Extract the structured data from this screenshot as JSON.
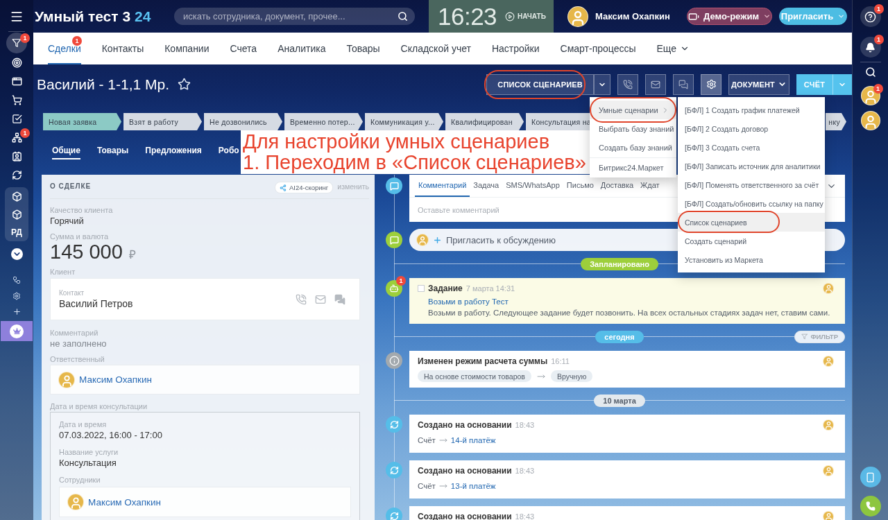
{
  "header": {
    "portal_name": "Умный тест 3",
    "portal_number": "24",
    "search": {
      "placeholder": "искать сотрудника, документ, прочее..."
    },
    "clock": {
      "time": "16:23",
      "start_button": "НАЧАТЬ"
    },
    "user": {
      "name": "Максим Охапкин"
    },
    "demo_button": "Демо-режим",
    "invite_button": "Пригласить"
  },
  "left_sidebar": {
    "filter_badge": "1",
    "people_badge": "1",
    "group_label": "РД"
  },
  "right_sidebar": {
    "help_badge": "1",
    "bell_badge": "1",
    "avatar_badge": "1"
  },
  "nav": {
    "tabs": [
      {
        "label": "Сделки",
        "selected": true,
        "badge": "1"
      },
      {
        "label": "Контакты",
        "selected": false
      },
      {
        "label": "Компании",
        "selected": false
      },
      {
        "label": "Счета",
        "selected": false
      },
      {
        "label": "Аналитика",
        "selected": false
      },
      {
        "label": "Товары",
        "selected": false
      },
      {
        "label": "Складской учет",
        "selected": false
      },
      {
        "label": "Настройки",
        "selected": false
      },
      {
        "label": "Смарт-процессы",
        "selected": false
      }
    ],
    "more": "Еще"
  },
  "deal": {
    "title": "Василий - 1-1,1 Мр.",
    "starred": false
  },
  "toolbar": {
    "scenarios_button": {
      "label": "СПИСОК СЦЕНАРИЕВ",
      "circled": true
    },
    "document_button": "ДОКУМЕНТ",
    "invoice_button": "СЧЁТ"
  },
  "stages": [
    {
      "label": "Новая заявка",
      "selected": true
    },
    {
      "label": "Взят в работу",
      "selected": false
    },
    {
      "label": "Не дозвонились",
      "selected": false
    },
    {
      "label": "Временно потер...",
      "selected": false
    },
    {
      "label": "Коммуникация у...",
      "selected": false
    },
    {
      "label": "Квалифицирован",
      "selected": false
    },
    {
      "label": "Консультация на",
      "selected": false
    },
    {
      "label": "нку",
      "selected": false
    }
  ],
  "detail_tabs": [
    {
      "label": "Общие",
      "selected": true
    },
    {
      "label": "Товары",
      "selected": false
    },
    {
      "label": "Предложения",
      "selected": false
    },
    {
      "label": "Робо",
      "selected": false
    }
  ],
  "about": {
    "title": "О СДЕЛКЕ",
    "scoring_badge": "AI24-скоринг",
    "edit_link": "изменить",
    "fields": [
      {
        "kind": "text",
        "label": "Качество клиента",
        "value": "Горячий",
        "muted": false
      },
      {
        "kind": "amount",
        "label": "Сумма и валюта",
        "value": "145 000",
        "currency": "₽"
      },
      {
        "kind": "contact",
        "label": "Клиент",
        "contact_label": "Контакт",
        "value": "Василий Петров"
      },
      {
        "kind": "text",
        "label": "Комментарий",
        "value": "не заполнено",
        "muted": true
      },
      {
        "kind": "person",
        "label": "Ответственный",
        "value": "Максим Охапкин"
      },
      {
        "kind": "group",
        "label": "Дата и время консультации",
        "fields": [
          {
            "kind": "text",
            "label": "Дата и время",
            "value": "07.03.2022, 16:00 - 17:00",
            "muted": false
          },
          {
            "kind": "text",
            "label": "Название услуги",
            "value": "Консультация",
            "muted": false
          },
          {
            "kind": "person",
            "label": "Сотрудники",
            "value": "Максим Охапкин"
          }
        ]
      }
    ]
  },
  "annotation": {
    "lines": [
      "Для настройки умных сценариев",
      "1. Переходим в «Список сценариев»"
    ]
  },
  "timeline": {
    "composer": {
      "tabs": [
        {
          "label": "Комментарий",
          "selected": true
        },
        {
          "label": "Задача",
          "selected": false
        },
        {
          "label": "SMS/WhatsApp",
          "selected": false
        },
        {
          "label": "Письмо",
          "selected": false
        },
        {
          "label": "Доставка",
          "selected": false
        },
        {
          "label": "Ждат",
          "selected": false
        }
      ],
      "placeholder": "Оставьте комментарий"
    },
    "invite": "Пригласить к обсуждению",
    "items": [
      {
        "kind": "divider",
        "label": "Запланировано",
        "color": "#9dcf3b"
      },
      {
        "kind": "task",
        "title": "Задание",
        "time": "7 марта 14:31",
        "link": "Возьми в работу Тест",
        "text": "Возьми в работу. Следующее задание будет позвонить. На всех остальных стадиях задач нет, ставим сами.",
        "badge": "1",
        "checked": false
      },
      {
        "kind": "divider",
        "label": "сегодня",
        "color": "#55bde8",
        "filter_button": "ФИЛЬТР"
      },
      {
        "kind": "change",
        "title": "Изменен режим расчета суммы",
        "time": "16:11",
        "from": "На основе стоимости товаров",
        "to": "Вручную"
      },
      {
        "kind": "divider",
        "label": "10 марта",
        "color": "#e3e9ee"
      },
      {
        "kind": "created",
        "title": "Создано на основании",
        "time": "18:43",
        "source": "Счёт",
        "link": "14-й платёж"
      },
      {
        "kind": "created",
        "title": "Создано на основании",
        "time": "18:43",
        "source": "Счёт",
        "link": "13-й платёж"
      },
      {
        "kind": "created",
        "title": "Создано на основании",
        "time": "18:43"
      }
    ]
  },
  "scenario_menu": {
    "items": [
      {
        "label": "Умные сценарии",
        "selected": true,
        "circled": true,
        "submenu": true,
        "separated": false
      },
      {
        "label": "Выбрать базу знаний",
        "selected": false,
        "circled": false,
        "submenu": false,
        "separated": false
      },
      {
        "label": "Создать базу знаний",
        "selected": false,
        "circled": false,
        "submenu": false,
        "separated": false
      },
      {
        "label": "Битрикс24.Маркет",
        "selected": false,
        "circled": false,
        "submenu": false,
        "separated": true
      }
    ]
  },
  "scenarios_submenu": {
    "items": [
      {
        "label": "[БФЛ] 1 Создать график платежей",
        "selected": false,
        "circled": false
      },
      {
        "label": "[БФЛ] 2 Создать договор",
        "selected": false,
        "circled": false
      },
      {
        "label": "[БФЛ] 3 Создать счета",
        "selected": false,
        "circled": false
      },
      {
        "label": "[БФЛ] Записать источник для аналитики",
        "selected": false,
        "circled": false
      },
      {
        "label": "[БФЛ] Поменять ответственного за счёт",
        "selected": false,
        "circled": false
      },
      {
        "label": "[БФЛ] Создать/обновить ссылку на папку",
        "selected": false,
        "circled": false
      },
      {
        "label": "Список сценариев",
        "selected": true,
        "circled": true
      },
      {
        "label": "Создать сценарий",
        "selected": false,
        "circled": false
      },
      {
        "label": "Установить из Маркета",
        "selected": false,
        "circled": false
      }
    ]
  }
}
